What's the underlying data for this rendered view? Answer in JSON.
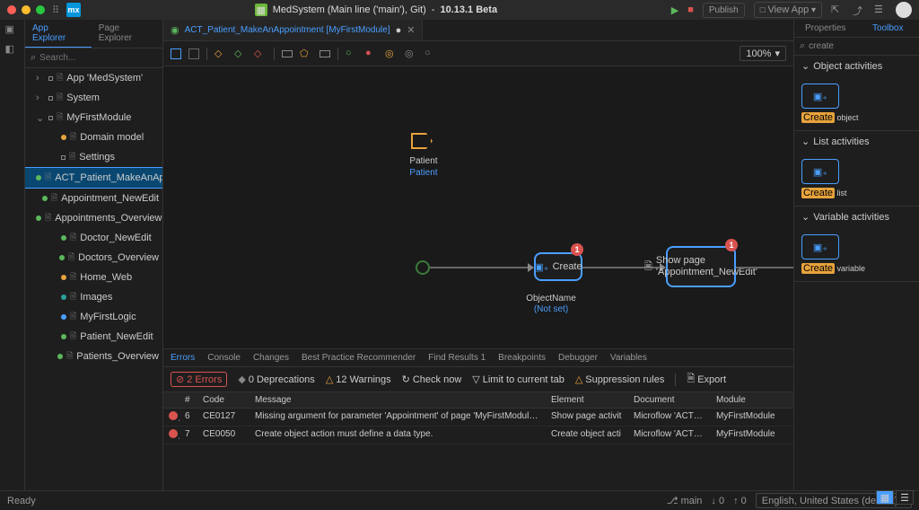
{
  "titlebar": {
    "app": "MedSystem (Main line ('main'), Git)",
    "version": "10.13.1 Beta",
    "publish": "Publish",
    "viewApp": "View App"
  },
  "explorer": {
    "tabs": [
      "App Explorer",
      "Page Explorer"
    ],
    "activeTab": 0,
    "searchPlaceholder": "Search...",
    "tree": [
      {
        "label": "App 'MedSystem'",
        "indent": 0,
        "expand": "›",
        "dot": ""
      },
      {
        "label": "System",
        "indent": 0,
        "expand": "›",
        "dot": ""
      },
      {
        "label": "MyFirstModule",
        "indent": 0,
        "expand": "⌄",
        "dot": "",
        "bold": true
      },
      {
        "label": "Domain model",
        "indent": 1,
        "dot": "d-yellow"
      },
      {
        "label": "Settings",
        "indent": 1,
        "dot": ""
      },
      {
        "label": "ACT_Patient_MakeAnAppoint...",
        "indent": 1,
        "dot": "d-green",
        "selected": true
      },
      {
        "label": "Appointment_NewEdit",
        "indent": 1,
        "dot": "d-green"
      },
      {
        "label": "Appointments_Overview",
        "indent": 1,
        "dot": "d-green"
      },
      {
        "label": "Doctor_NewEdit",
        "indent": 1,
        "dot": "d-green"
      },
      {
        "label": "Doctors_Overview",
        "indent": 1,
        "dot": "d-green"
      },
      {
        "label": "Home_Web",
        "indent": 1,
        "dot": "d-yellow"
      },
      {
        "label": "Images",
        "indent": 1,
        "dot": "d-teal"
      },
      {
        "label": "MyFirstLogic",
        "indent": 1,
        "dot": "d-blue"
      },
      {
        "label": "Patient_NewEdit",
        "indent": 1,
        "dot": "d-green"
      },
      {
        "label": "Patients_Overview",
        "indent": 1,
        "dot": "d-green"
      }
    ]
  },
  "document": {
    "tabTitle": "ACT_Patient_MakeAnAppointment [MyFirstModule]",
    "zoom": "100%",
    "param": {
      "label": "Patient",
      "type": "Patient"
    },
    "action1": {
      "label": "Create",
      "sub1": "ObjectName",
      "sub2": "(Not set)",
      "badge": "1"
    },
    "action2": {
      "line1": "Show page",
      "line2": "'Appointment_NewEdit'",
      "badge": "1"
    }
  },
  "bottomPanel": {
    "tabs": [
      "Errors",
      "Console",
      "Changes",
      "Best Practice Recommender",
      "Find Results 1",
      "Breakpoints",
      "Debugger",
      "Variables"
    ],
    "activeTab": 0,
    "filters": {
      "errors": "2 Errors",
      "deprecations": "0 Deprecations",
      "warnings": "12 Warnings",
      "checkNow": "Check now",
      "limit": "Limit to current tab",
      "suppression": "Suppression rules",
      "export": "Export"
    },
    "headers": [
      "",
      "#",
      "Code",
      "Message",
      "Element",
      "Document",
      "Module"
    ],
    "rows": [
      {
        "n": "6",
        "code": "CE0127",
        "msg": "Missing argument for parameter 'Appointment' of page 'MyFirstModule.Ap",
        "el": "Show page activit",
        "doc": "Microflow 'ACT_Pa",
        "mod": "MyFirstModule"
      },
      {
        "n": "7",
        "code": "CE0050",
        "msg": "Create object action must define a data type.",
        "el": "Create object acti",
        "doc": "Microflow 'ACT_Pa",
        "mod": "MyFirstModule"
      }
    ]
  },
  "rightPanel": {
    "tabs": [
      "Properties",
      "Toolbox"
    ],
    "activeTab": 1,
    "searchValue": "create",
    "sections": [
      {
        "title": "Object activities",
        "item": "object"
      },
      {
        "title": "List activities",
        "item": "list"
      },
      {
        "title": "Variable activities",
        "item": "variable"
      }
    ],
    "createWord": "Create"
  },
  "statusbar": {
    "ready": "Ready",
    "branch": "main",
    "down": "0",
    "up": "0",
    "lang": "English, United States (default)"
  }
}
